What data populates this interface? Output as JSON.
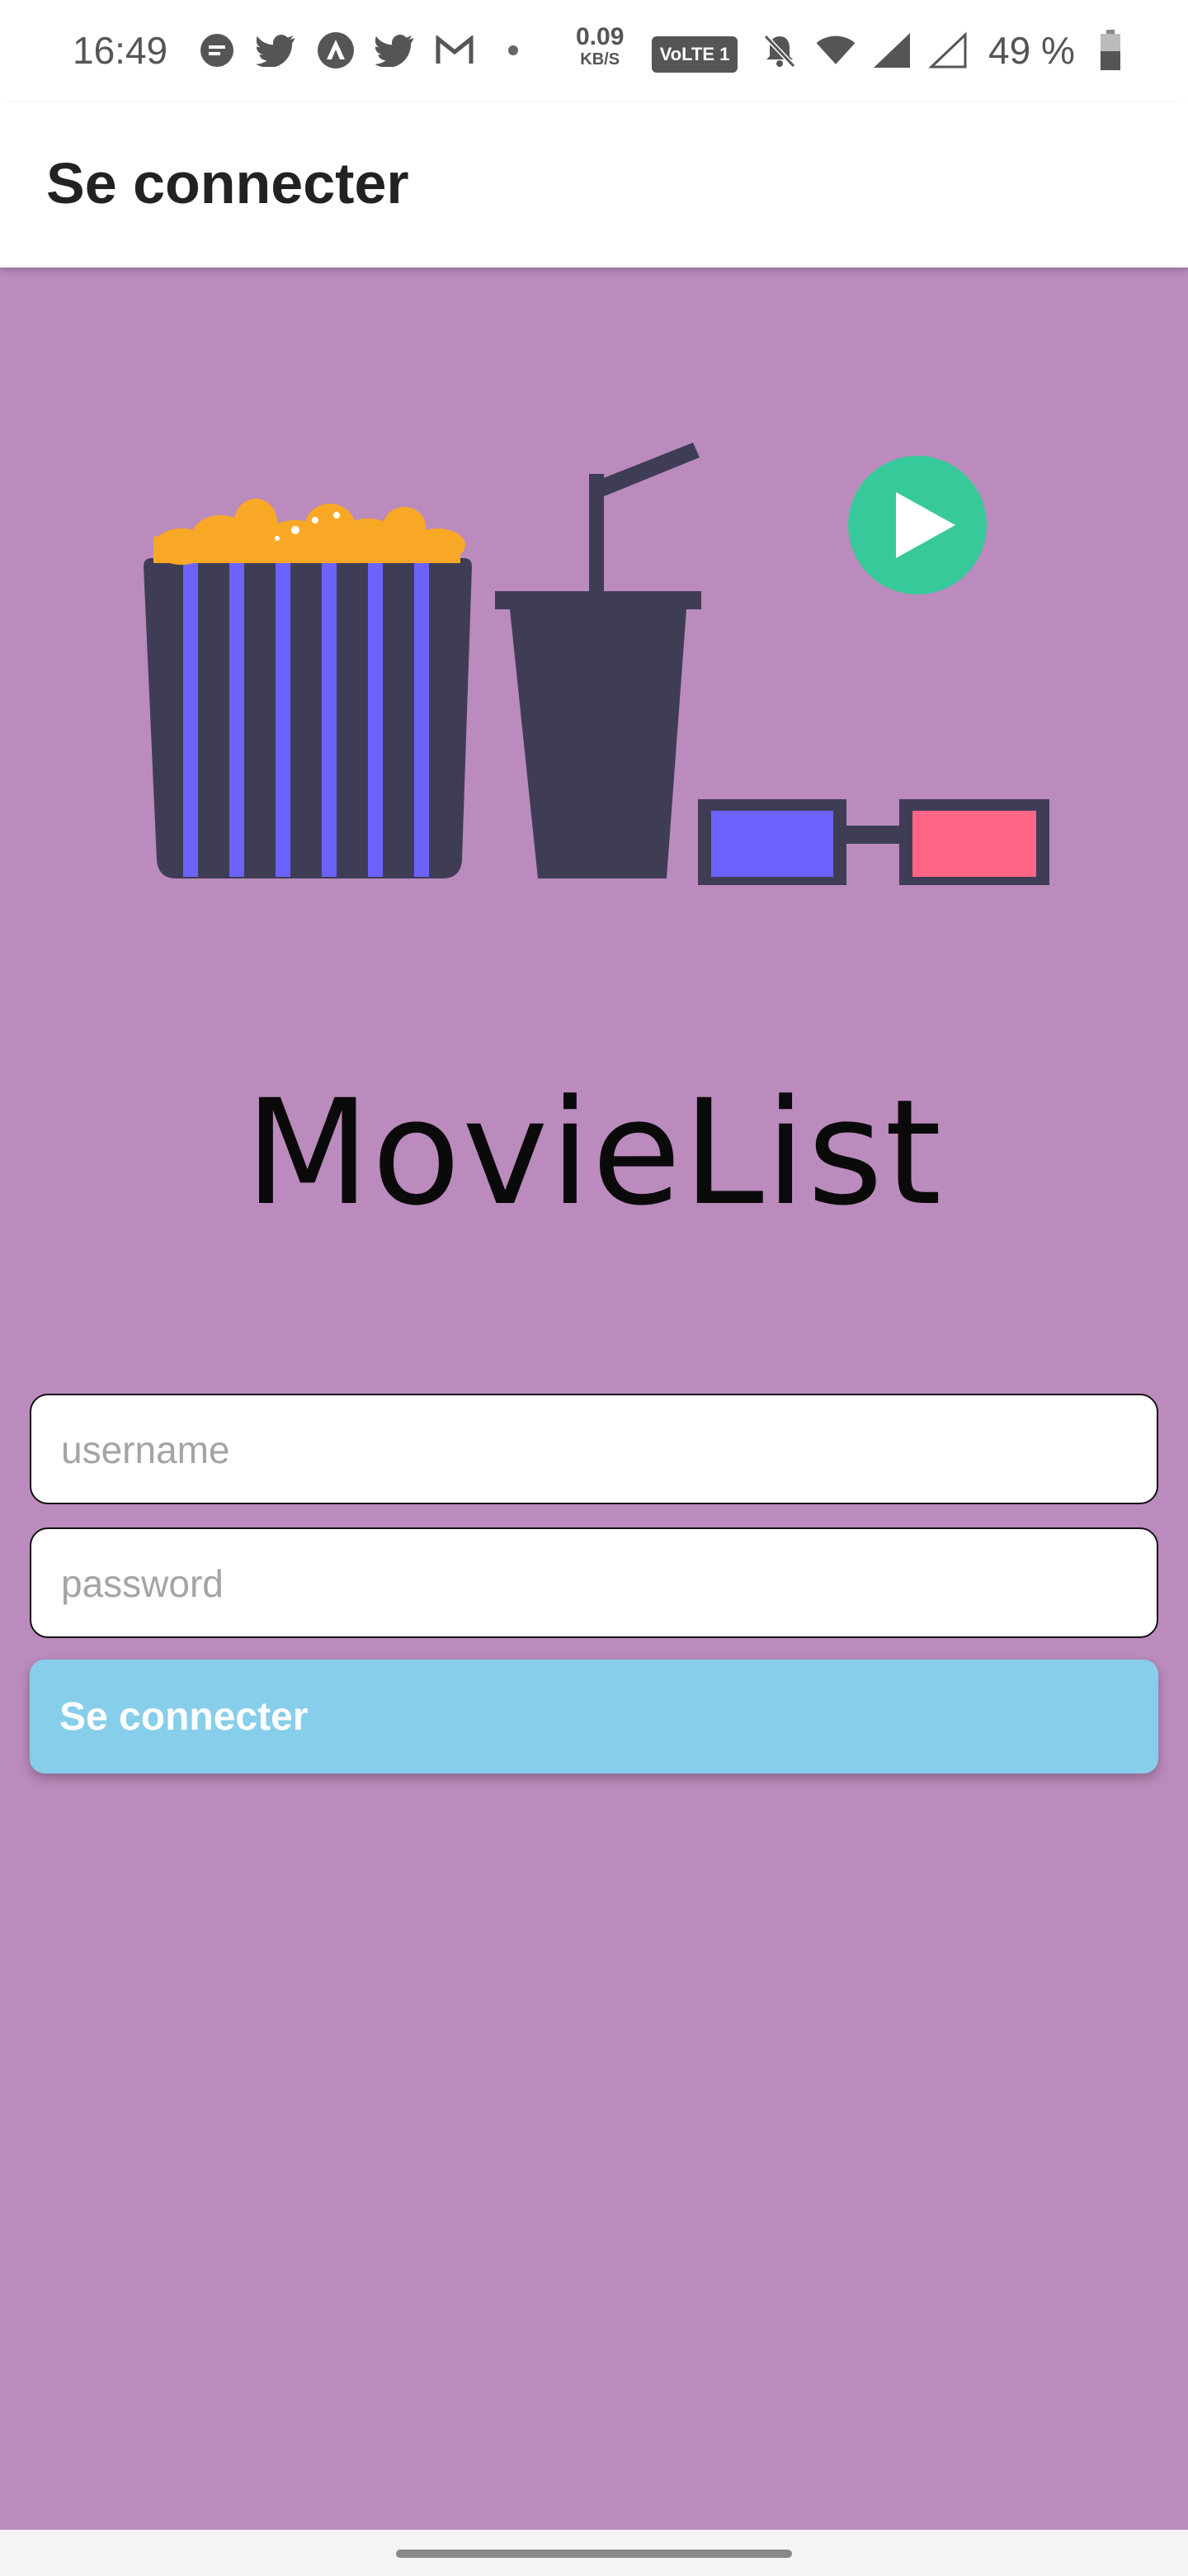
{
  "status_bar": {
    "time": "16:49",
    "speed_value": "0.09",
    "speed_unit": "KB/S",
    "volte": "VoLTE 1",
    "battery": "49 %",
    "icons": [
      "messaging-icon",
      "twitter-icon",
      "arrow-app-icon",
      "twitter-icon",
      "gmail-icon",
      "dot-icon",
      "mute-icon",
      "wifi-icon",
      "signal-icon",
      "signal-empty-icon",
      "battery-icon"
    ]
  },
  "app_bar": {
    "title": "Se connecter"
  },
  "main": {
    "app_name": "MovieList",
    "username_placeholder": "username",
    "password_placeholder": "password",
    "login_button": "Se connecter"
  },
  "colors": {
    "background": "#bb8bbd",
    "button": "#87ceea",
    "popcorn": "#f9a826",
    "stripe": "#6c63ff",
    "dark": "#3f3d56",
    "play": "#38c99b",
    "glasses_red": "#ff6584"
  }
}
